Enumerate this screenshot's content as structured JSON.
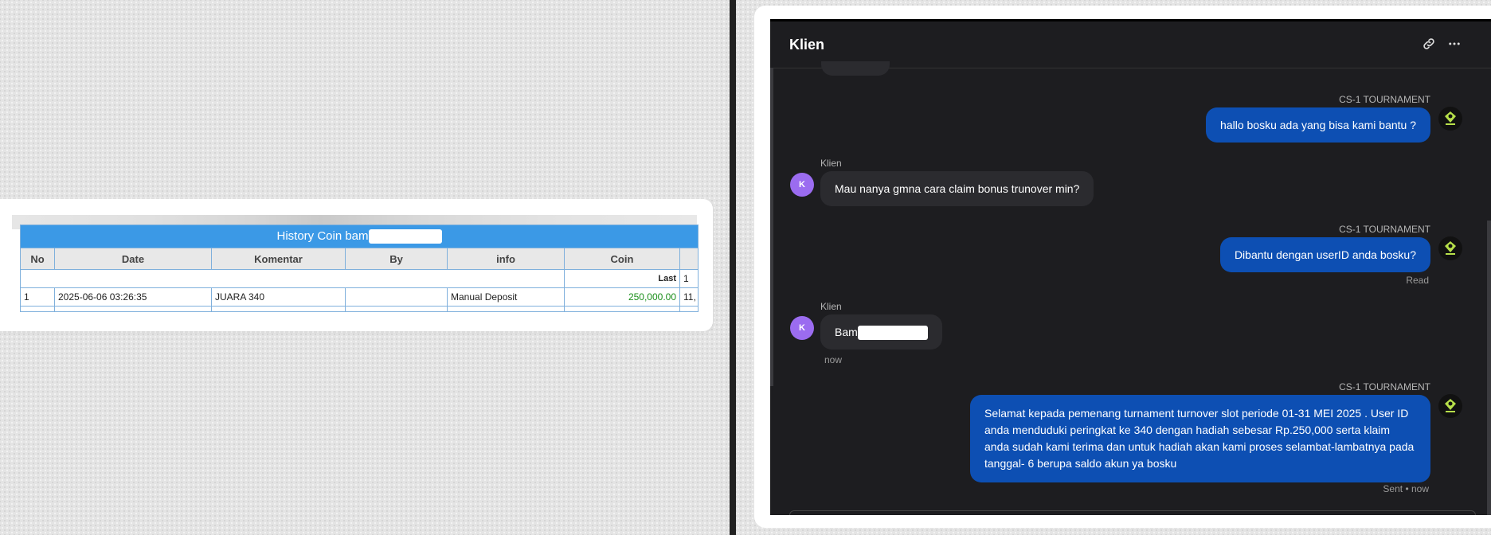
{
  "history": {
    "title": "History Coin bam",
    "columns": [
      "No",
      "Date",
      "Komentar",
      "By",
      "info",
      "Coin",
      ""
    ],
    "summary_row": {
      "label": "Last",
      "next": "1"
    },
    "rows": [
      {
        "no": "1",
        "date": "2025-06-06 03:26:35",
        "komentar": "JUARA 340",
        "by": "",
        "info": "Manual Deposit",
        "coin": "250,000.00",
        "extra": "11,"
      }
    ]
  },
  "chat": {
    "title": "Klien",
    "icons": {
      "link": "link-icon",
      "more": "more-icon"
    },
    "messages": [
      {
        "sender": "CS-1 TOURNAMENT",
        "text": "hallo bosku ada yang bisa kami bantu ?",
        "direction": "out"
      },
      {
        "sender": "Klien",
        "avatar": "K",
        "text": "Mau nanya gmna cara claim bonus trunover min?",
        "direction": "in"
      },
      {
        "sender": "CS-1 TOURNAMENT",
        "text": "Dibantu dengan userID anda bosku?",
        "direction": "out",
        "status": "Read"
      },
      {
        "sender": "Klien",
        "avatar": "K",
        "text": "Bam",
        "direction": "in",
        "time": "now"
      },
      {
        "sender": "CS-1 TOURNAMENT",
        "text": "Selamat kepada pemenang turnament turnover slot periode 01-31 MEI 2025 . User ID anda menduduki peringkat ke 340 dengan hadiah sebesar Rp.250,000 serta klaim anda sudah kami terima dan untuk hadiah akan kami proses selambat-lambatnya pada tanggal- 6 berupa saldo akun ya bosku",
        "direction": "out",
        "status": "Sent • now"
      }
    ]
  },
  "colors": {
    "table_header": "#3b99e6",
    "outgoing_bubble": "#0d4fb3",
    "incoming_bubble": "#2b2b2f",
    "avatar": "#9b6cf0",
    "coin_green": "#1b8f1b"
  }
}
